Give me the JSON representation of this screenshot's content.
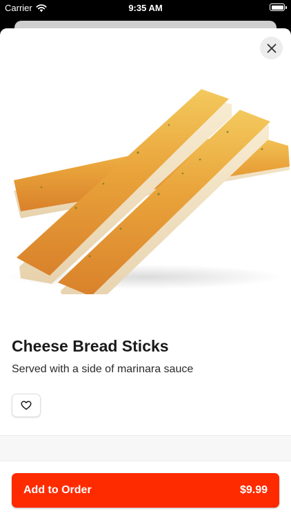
{
  "status_bar": {
    "carrier": "Carrier",
    "time": "9:35 AM",
    "battery_level": 1.0
  },
  "item": {
    "name": "Cheese Bread Sticks",
    "description": "Served with a side of marinara sauce",
    "image_icon": "cheese-bread-sticks-photo"
  },
  "actions": {
    "close_icon": "close-icon",
    "favorite_icon": "heart-outline-icon",
    "add_label": "Add to Order",
    "price": "$9.99"
  },
  "colors": {
    "accent": "#ff2b00",
    "background": "#ffffff",
    "status_bar": "#000000"
  }
}
